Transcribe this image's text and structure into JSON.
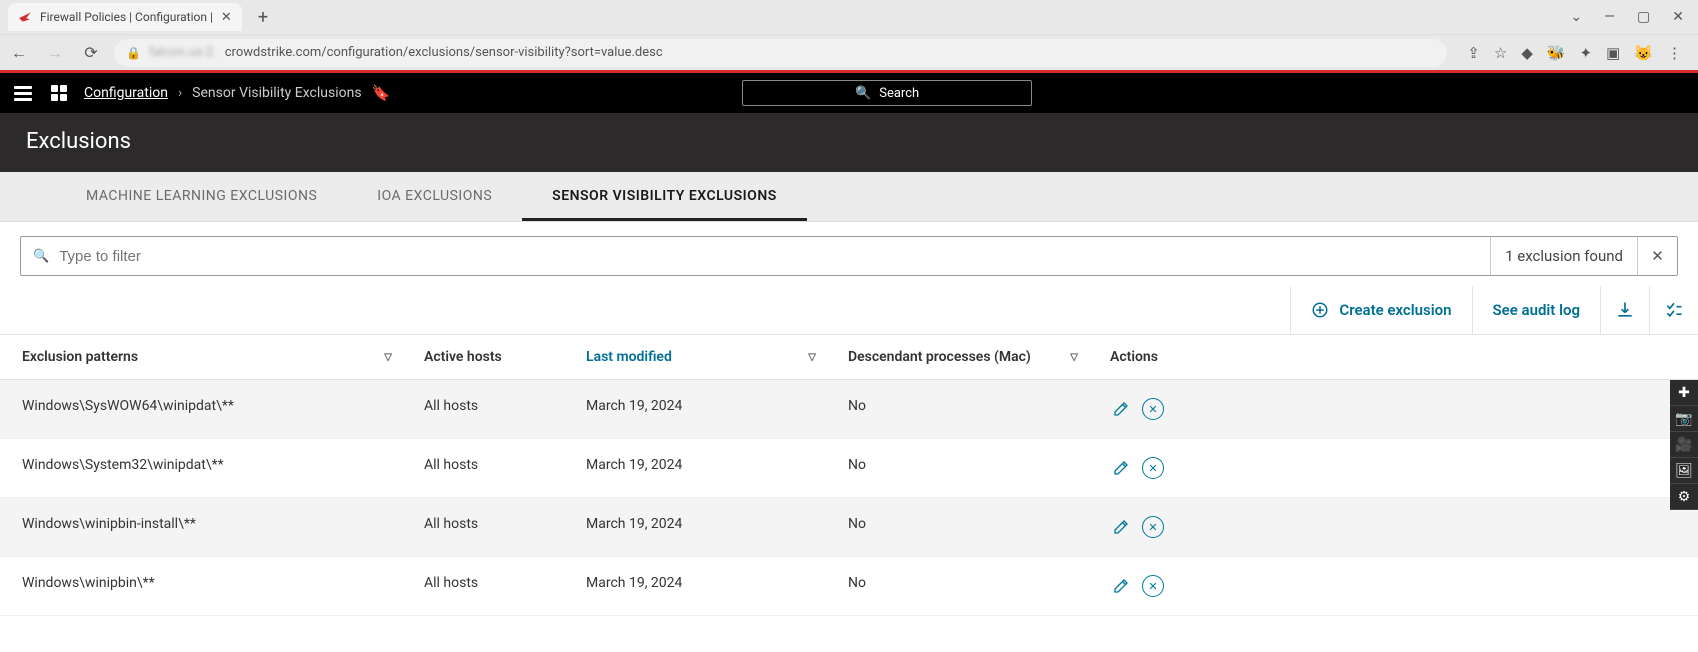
{
  "browser": {
    "tab_title": "Firewall Policies | Configuration |",
    "url_host_blur": "falcon.us-2.",
    "url_rest": "crowdstrike.com/configuration/exclusions/sensor-visibility?sort=value.desc"
  },
  "header": {
    "breadcrumb_root": "Configuration",
    "breadcrumb_leaf": "Sensor Visibility Exclusions",
    "search_label": "Search"
  },
  "page": {
    "title": "Exclusions"
  },
  "tabs": {
    "ml": "MACHINE LEARNING EXCLUSIONS",
    "ioa": "IOA EXCLUSIONS",
    "sve": "SENSOR VISIBILITY EXCLUSIONS"
  },
  "filter": {
    "placeholder": "Type to filter",
    "count": "1 exclusion found"
  },
  "actions": {
    "create": "Create exclusion",
    "audit": "See audit log"
  },
  "columns": {
    "pattern": "Exclusion patterns",
    "hosts": "Active hosts",
    "modified": "Last modified",
    "descendant": "Descendant processes (Mac)",
    "actions": "Actions"
  },
  "rows": [
    {
      "pattern": "Windows\\SysWOW64\\winipdat\\**",
      "hosts": "All hosts",
      "modified": "March 19, 2024",
      "descendant": "No"
    },
    {
      "pattern": "Windows\\System32\\winipdat\\**",
      "hosts": "All hosts",
      "modified": "March 19, 2024",
      "descendant": "No"
    },
    {
      "pattern": "Windows\\winipbin-install\\**",
      "hosts": "All hosts",
      "modified": "March 19, 2024",
      "descendant": "No"
    },
    {
      "pattern": "Windows\\winipbin\\**",
      "hosts": "All hosts",
      "modified": "March 19, 2024",
      "descendant": "No"
    }
  ]
}
